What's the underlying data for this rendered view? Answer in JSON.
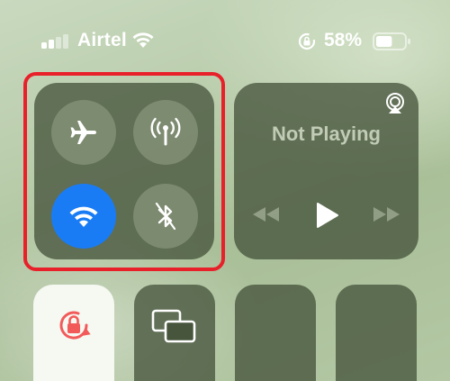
{
  "status_bar": {
    "carrier": "Airtel",
    "signal_bars_active": 2,
    "signal_bars_total": 4,
    "battery_percent": "58%",
    "battery_level": 0.58
  },
  "connectivity": {
    "airplane_mode": {
      "icon": "airplane-icon",
      "active": false
    },
    "cellular_data": {
      "icon": "antenna-icon",
      "active": false
    },
    "wifi": {
      "icon": "wifi-icon",
      "active": true
    },
    "bluetooth": {
      "icon": "bluetooth-off-icon",
      "active": false
    }
  },
  "media": {
    "status": "Not Playing",
    "airplay_icon": "airplay-icon",
    "controls": [
      "rewind-icon",
      "play-icon",
      "fast-forward-icon"
    ]
  },
  "tiles": {
    "rotation_lock_icon": "rotation-lock-icon",
    "screen_mirroring_icon": "screen-mirroring-icon"
  },
  "colors": {
    "highlight": "#e8202a",
    "wifi_active": "#1a7cf5",
    "rotation_lock": "#f25a5a"
  }
}
